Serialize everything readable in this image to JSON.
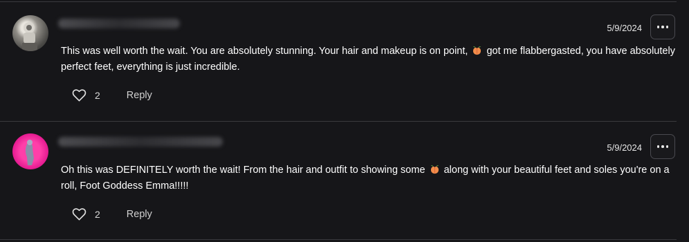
{
  "comments": [
    {
      "date": "5/9/2024",
      "text_before": "This was well worth the wait. You are absolutely stunning. Your hair and makeup is on point,",
      "text_after": "got me flabbergasted, you have absolutely perfect feet, everything is just incredible.",
      "likes": "2",
      "reply_label": "Reply"
    },
    {
      "date": "5/9/2024",
      "text_before": "Oh this was DEFINITELY worth the wait! From the hair and outfit to showing some",
      "text_after": "along with your beautiful feet and soles you're on a roll, Foot Goddess Emma!!!!!",
      "likes": "2",
      "reply_label": "Reply"
    }
  ],
  "icons": {
    "emoji": "peach-emoji",
    "like": "heart-icon",
    "more": "more-options-icon"
  },
  "colors": {
    "background": "#161619",
    "avatar_pink": "#e0148c",
    "peach": "#f28c4a"
  }
}
